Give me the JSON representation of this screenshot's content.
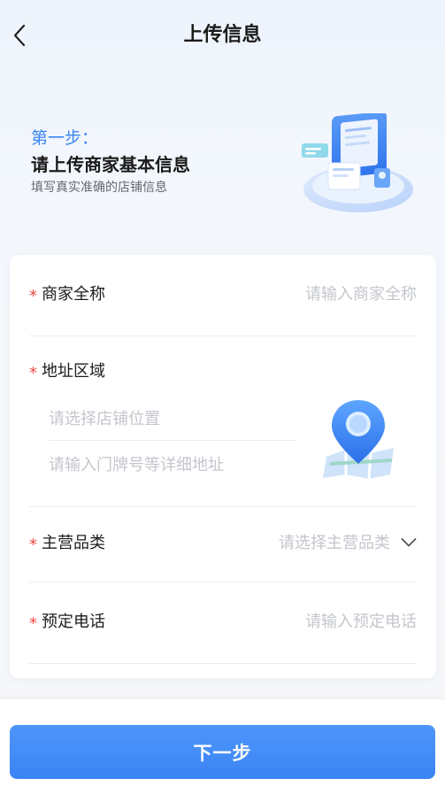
{
  "header": {
    "title": "上传信息",
    "back_icon": "chevron-left-icon"
  },
  "intro": {
    "step_label": "第一步：",
    "title": "请上传商家基本信息",
    "description": "填写真实准确的店铺信息",
    "illustration_icon": "document-upload-illustration"
  },
  "form": {
    "required_mark": "*",
    "merchant_name": {
      "label": "商家全称",
      "placeholder": "请输入商家全称"
    },
    "address": {
      "label": "地址区域",
      "location_placeholder": "请选择店铺位置",
      "detail_placeholder": "请输入门牌号等详细地址",
      "icon": "map-pin-icon"
    },
    "category": {
      "label": "主营品类",
      "placeholder": "请选择主营品类",
      "icon": "chevron-down-icon"
    },
    "phone": {
      "label": "预定电话",
      "placeholder": "请输入预定电话"
    }
  },
  "footer": {
    "next_label": "下一步"
  },
  "colors": {
    "accent": "#3a86f2",
    "required": "#f04a44",
    "placeholder": "#c3c6cc"
  }
}
